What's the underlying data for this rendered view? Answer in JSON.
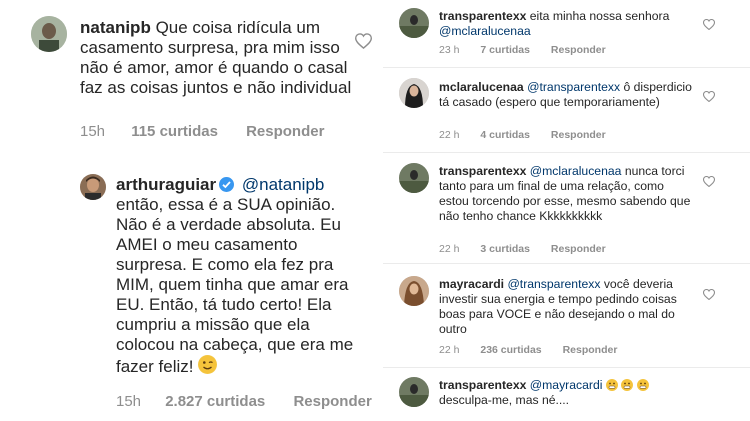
{
  "left": {
    "comment1": {
      "username": "natanipb",
      "text": "Que coisa ridícula um casamento surpresa, pra mim isso não é amor, amor é quando o casal faz as coisas juntos e não individual",
      "time": "15h",
      "likes": "115 curtidas",
      "reply": "Responder"
    },
    "comment2": {
      "username": "arthuraguiar",
      "mention": "@natanipb",
      "text": "então, essa é a SUA opinião. Não é a verdade absoluta. Eu AMEI o meu casamento surpresa. E como ela fez pra MIM, quem tinha que amar era EU. Então, tá tudo certo! Ela cumpriu a missão que ela colocou na cabeça, que era me fazer feliz!",
      "emoji": "wink-emoji",
      "time": "15h",
      "likes": "2.827 curtidas",
      "reply": "Responder"
    }
  },
  "right": {
    "comments": [
      {
        "username": "transparentexx",
        "text_before": "eita minha nossa senhora",
        "mention": "@mclaralucenaa",
        "text": "",
        "time": "23 h",
        "likes": "7 curtidas",
        "reply": "Responder"
      },
      {
        "username": "mclaralucenaa",
        "mention": "@transparentexx",
        "text": "ô disperdicio tá casado (espero que temporariamente)",
        "time": "22 h",
        "likes": "4 curtidas",
        "reply": "Responder"
      },
      {
        "username": "transparentexx",
        "mention": "@mclaralucenaa",
        "text": "nunca torci tanto para um final de uma relação, como estou torcendo por esse, mesmo sabendo que não tenho chance Kkkkkkkkkk",
        "time": "22 h",
        "likes": "3 curtidas",
        "reply": "Responder"
      },
      {
        "username": "mayracardi",
        "mention": "@transparentexx",
        "text": "você deveria investir sua energia e tempo pedindo coisas boas para VOCE e não desejando o mal do outro",
        "time": "22 h",
        "likes": "236 curtidas",
        "reply": "Responder"
      },
      {
        "username": "transparentexx",
        "mention": "@mayracardi",
        "text": "desculpa-me, mas né....",
        "emoji": "grimacing-emoji"
      }
    ]
  },
  "colors": {
    "text": "#262626",
    "mention": "#00376b",
    "meta": "#8e8e8e",
    "verified": "#3897f0"
  },
  "icons": [
    "heart-icon",
    "verified-badge-icon",
    "wink-emoji",
    "grimacing-emoji"
  ]
}
